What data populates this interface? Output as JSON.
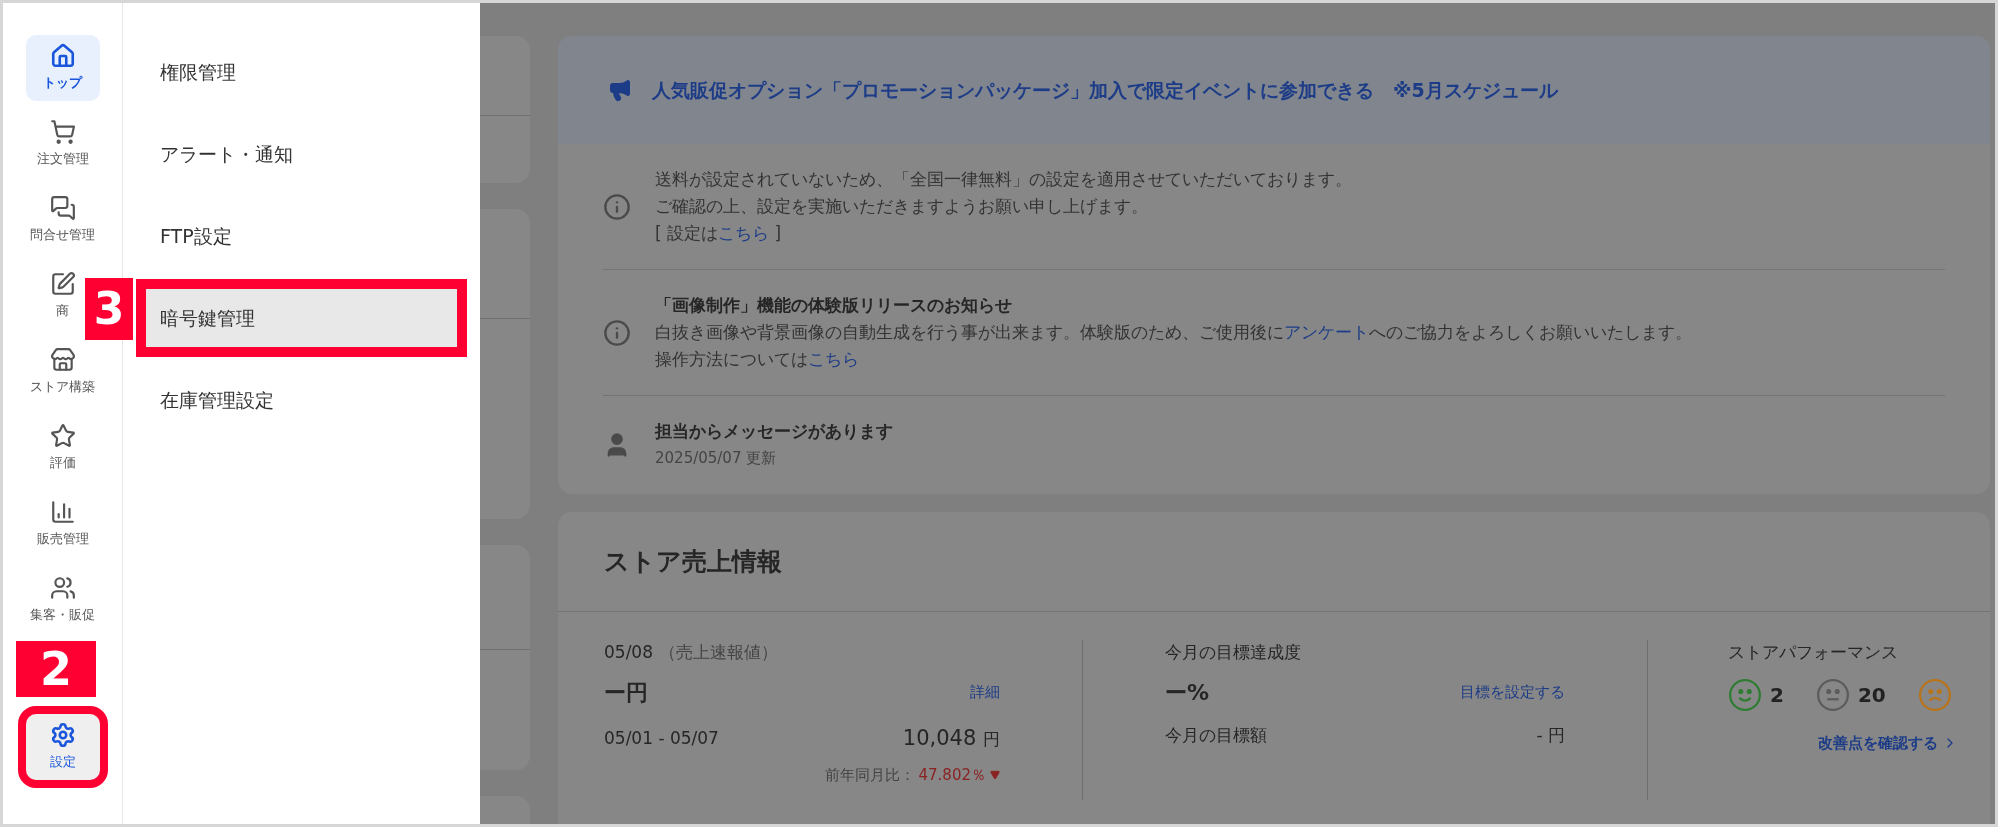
{
  "sidebar": {
    "items": [
      {
        "label": "トップ",
        "selected": true,
        "open": false
      },
      {
        "label": "注文管理",
        "selected": false,
        "open": false
      },
      {
        "label": "問合せ管理",
        "selected": false,
        "open": false
      },
      {
        "label": "商",
        "selected": false,
        "open": false
      },
      {
        "label": "ストア構築",
        "selected": false,
        "open": false
      },
      {
        "label": "評価",
        "selected": false,
        "open": false
      },
      {
        "label": "販売管理",
        "selected": false,
        "open": false
      },
      {
        "label": "集客・販促",
        "selected": false,
        "open": false
      },
      {
        "label": "設定",
        "selected": false,
        "open": true,
        "highlighted": true
      }
    ]
  },
  "submenu": {
    "items": [
      {
        "label": "権限管理",
        "selected": false
      },
      {
        "label": "アラート・通知",
        "selected": false
      },
      {
        "label": "FTP設定",
        "selected": false
      },
      {
        "label": "暗号鍵管理",
        "selected": true,
        "highlighted": true
      },
      {
        "label": "在庫管理設定",
        "selected": false
      }
    ]
  },
  "annotations": [
    {
      "label": "2"
    },
    {
      "label": "3"
    }
  ],
  "banner": {
    "text": "人気販促オプション「プロモーションパッケージ」加入で限定イベントに参加できる　※5月スケジュール"
  },
  "notices": [
    {
      "kind": "info",
      "lines": [
        [
          {
            "text": "送料が設定されていないため、「全国一律無料」の設定を適用させていただいております。",
            "link": false
          }
        ],
        [
          {
            "text": "ご確認の上、設定を実施いただきますようお願い申し上げます。",
            "link": false
          }
        ],
        [
          {
            "text": "[ 設定は",
            "link": false
          },
          {
            "text": "こちら",
            "link": true
          },
          {
            "text": " ]",
            "link": false
          }
        ]
      ]
    },
    {
      "kind": "info",
      "title": "「画像制作」機能の体験版リリースのお知らせ",
      "lines": [
        [
          {
            "text": "白抜き画像や背景画像の自動生成を行う事が出来ます。体験版のため、ご使用後に",
            "link": false
          },
          {
            "text": "アンケート",
            "link": true
          },
          {
            "text": "へのご協力をよろしくお願いいたします。",
            "link": false
          }
        ],
        [
          {
            "text": "操作方法については",
            "link": false
          },
          {
            "text": "こちら",
            "link": true
          }
        ]
      ]
    },
    {
      "kind": "person",
      "title": "担当からメッセージがあります",
      "date": "2025/05/07 更新"
    }
  ],
  "sales": {
    "title": "ストア売上情報",
    "daily": {
      "date": "05/08",
      "note": "（売上速報値）",
      "value": "ー円",
      "link": "詳細",
      "range": "05/01 - 05/07",
      "amount": "10,048",
      "unit": "円",
      "compare_label": "前年同月比：",
      "compare_value": "47.802％"
    },
    "goal": {
      "title": "今月の目標達成度",
      "value": "ー%",
      "link": "目標を設定する",
      "amount_label": "今月の目標額",
      "amount": "- 円"
    },
    "performance": {
      "title": "ストアパフォーマンス",
      "faces": [
        {
          "kind": "happy",
          "color": "#2e7d32",
          "count": "2"
        },
        {
          "kind": "neutral",
          "color": "#5c5c5c",
          "count": "20"
        },
        {
          "kind": "sad",
          "color": "#b8741a"
        }
      ],
      "link": "改善点を確認する"
    }
  }
}
